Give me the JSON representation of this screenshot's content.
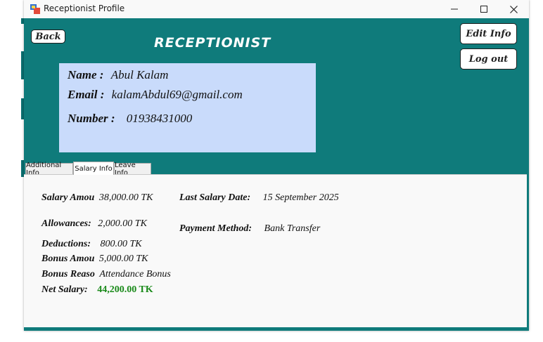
{
  "window": {
    "title": "Receptionist Profile"
  },
  "header": {
    "back_label": "Back",
    "heading": "RECEPTIONIST",
    "edit_label": "Edit Info",
    "logout_label": "Log out"
  },
  "profile": {
    "name_label": "Name :",
    "name_value": "Abul Kalam",
    "email_label": "Email :",
    "email_value": "kalamAbdul69@gmail.com",
    "number_label": "Number :",
    "number_value": "01938431000"
  },
  "tabs": [
    {
      "label": "Additional Info"
    },
    {
      "label": "Salary Info"
    },
    {
      "label": "Leave Info"
    }
  ],
  "salary": {
    "amount_label": "Salary Amou",
    "amount_value": "38,000.00 TK",
    "last_date_label": "Last Salary Date:",
    "last_date_value": "15 September 2025",
    "allowances_label": "Allowances:",
    "allowances_value": "2,000.00 TK",
    "payment_method_label": "Payment Method:",
    "payment_method_value": "Bank Transfer",
    "deductions_label": "Deductions:",
    "deductions_value": "800.00 TK",
    "bonus_amount_label": "Bonus Amou",
    "bonus_amount_value": "5,000.00 TK",
    "bonus_reason_label": "Bonus Reaso",
    "bonus_reason_value": "Attendance Bonus",
    "net_label": "Net Salary:",
    "net_value": "44,200.00 TK"
  },
  "colors": {
    "client_bg": "#0f7b7b",
    "profile_panel": "#c9dbfb",
    "net_salary": "#1a8a1a"
  }
}
